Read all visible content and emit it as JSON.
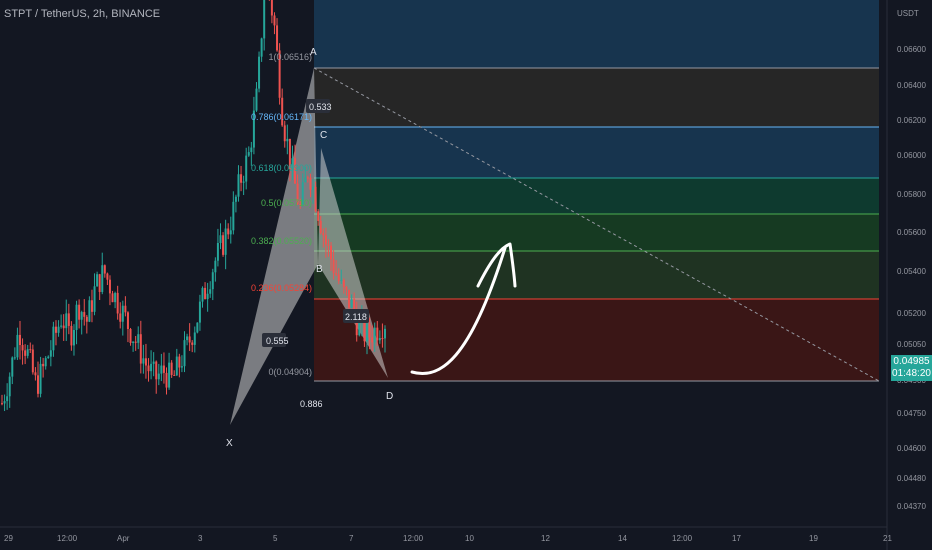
{
  "header": {
    "title": "STPT / TetherUS, 2h, BINANCE"
  },
  "price_scale": {
    "unit": "USDT",
    "ticks": [
      "0.06600",
      "0.06400",
      "0.06200",
      "0.06000",
      "0.05800",
      "0.05600",
      "0.05400",
      "0.05200",
      "0.05050",
      "0.04900",
      "0.04750",
      "0.04600",
      "0.04480",
      "0.04370"
    ],
    "current_price": "0.04985",
    "countdown": "01:48:20"
  },
  "time_scale": {
    "ticks": [
      "29",
      "12:00",
      "Apr",
      "3",
      "5",
      "7",
      "12:00",
      "10",
      "12",
      "14",
      "12:00",
      "17",
      "19",
      "21"
    ]
  },
  "fib_levels": [
    {
      "label": "1(0.06516)",
      "color": "#9598a1"
    },
    {
      "label": "0.786(0.06171)",
      "color": "#64b5f6"
    },
    {
      "label": "0.618(0.05900)",
      "color": "#26a69a"
    },
    {
      "label": "0.5(0.05710)",
      "color": "#4caf50"
    },
    {
      "label": "0.382(0.05520)",
      "color": "#4caf50"
    },
    {
      "label": "0.236(0.05284)",
      "color": "#f44336"
    },
    {
      "label": "0(0.04904)",
      "color": "#9598a1"
    }
  ],
  "pattern": {
    "points": [
      "X",
      "A",
      "B",
      "C",
      "D"
    ],
    "ratios": [
      "0.555",
      "0.533",
      "2.118",
      "0.886"
    ]
  },
  "colors": {
    "up": "#26a69a",
    "down": "#ef5350",
    "background": "#131722",
    "pattern_fill": "#cfcfcf"
  },
  "chart_data": {
    "type": "candlestick",
    "title": "STPT / TetherUS, 2h, BINANCE",
    "y_unit": "USDT",
    "ylim": [
      0.043,
      0.068
    ],
    "harmonic_pattern": {
      "X": 0.0473,
      "A": 0.06516,
      "B": 0.0543,
      "C": 0.0617,
      "D": 0.049,
      "ratios": {
        "XB": 0.555,
        "AC": 0.533,
        "BD": 2.118,
        "XD": 0.886
      }
    },
    "fibonacci_retracement": [
      {
        "level": 1,
        "price": 0.06516
      },
      {
        "level": 0.786,
        "price": 0.06171
      },
      {
        "level": 0.618,
        "price": 0.059
      },
      {
        "level": 0.5,
        "price": 0.0571
      },
      {
        "level": 0.382,
        "price": 0.0552
      },
      {
        "level": 0.236,
        "price": 0.05284
      },
      {
        "level": 0,
        "price": 0.04904
      }
    ],
    "price_path_approx": [
      0.0465,
      0.0478,
      0.0495,
      0.0485,
      0.0472,
      0.048,
      0.049,
      0.05,
      0.0492,
      0.0505,
      0.0498,
      0.0512,
      0.0518,
      0.051,
      0.0503,
      0.0495,
      0.0488,
      0.048,
      0.0475,
      0.0478,
      0.0474,
      0.0482,
      0.049,
      0.05,
      0.0512,
      0.0522,
      0.053,
      0.054,
      0.0555,
      0.0565,
      0.059,
      0.064,
      0.0617,
      0.058,
      0.056,
      0.0543,
      0.056,
      0.0545,
      0.053,
      0.052,
      0.051,
      0.0505,
      0.0495,
      0.0492,
      0.0495,
      0.0498
    ]
  }
}
